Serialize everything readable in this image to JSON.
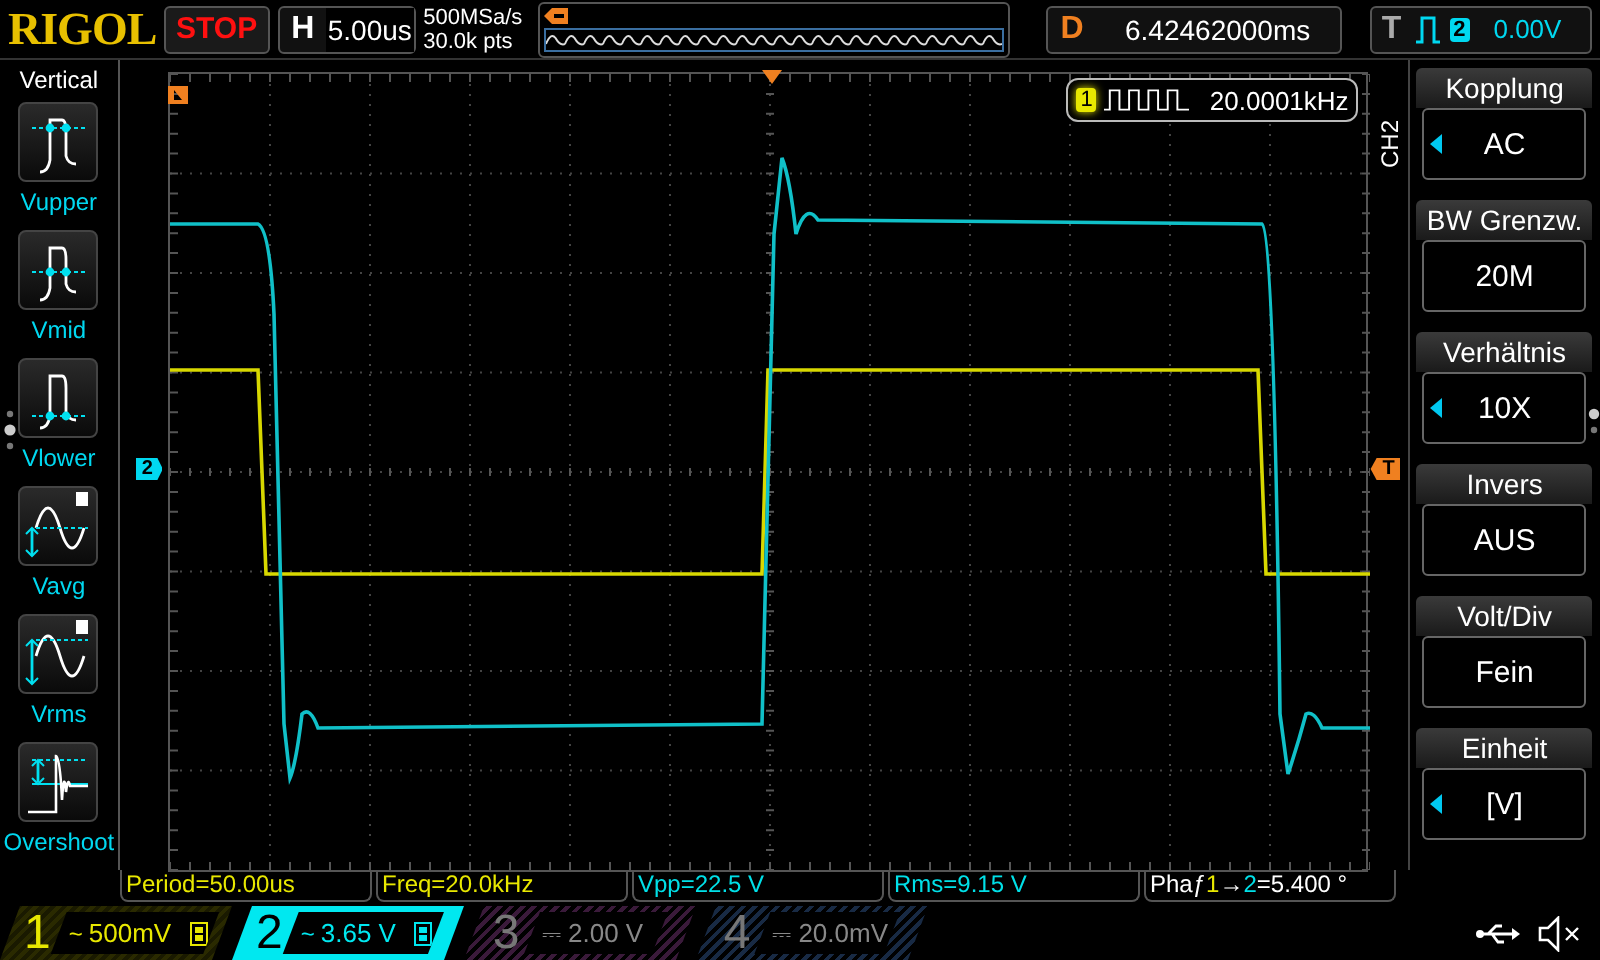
{
  "top_bar": {
    "logo": "RIGOL",
    "run_state": "STOP",
    "timebase": {
      "label": "H",
      "value": "5.00us"
    },
    "sample_rate": "500MSa/s",
    "memory_depth": "30.0k pts",
    "delay": {
      "label": "D",
      "value": "6.42462000ms"
    },
    "trigger": {
      "label": "T",
      "source": "2",
      "level": "0.00V"
    }
  },
  "left_menu": {
    "title": "Vertical",
    "items": [
      {
        "kind": "vupper",
        "label": "Vupper"
      },
      {
        "kind": "vmid",
        "label": "Vmid"
      },
      {
        "kind": "vlower",
        "label": "Vlower"
      },
      {
        "kind": "vavg",
        "label": "Vavg"
      },
      {
        "kind": "vrms",
        "label": "Vrms"
      },
      {
        "kind": "overshoot",
        "label": "Overshoot"
      }
    ]
  },
  "display": {
    "frequency_counter": {
      "channel": "1",
      "value": "20.0001kHz"
    },
    "trigger_marker": "T",
    "channel_marker": "2"
  },
  "right_menu": {
    "channel": "CH2",
    "items": [
      {
        "title": "Kopplung",
        "value": "AC",
        "has_options": true
      },
      {
        "title": "BW Grenzw.",
        "value": "20M",
        "has_options": false
      },
      {
        "title": "Verhältnis",
        "value": "10X",
        "has_options": true
      },
      {
        "title": "Invers",
        "value": "AUS",
        "has_options": false
      },
      {
        "title": "Volt/Div",
        "value": "Fein",
        "has_options": false
      },
      {
        "title": "Einheit",
        "value": "[V]",
        "has_options": true
      }
    ]
  },
  "measurements": [
    {
      "text": "Period=50.00us",
      "color": "#e8e800"
    },
    {
      "text": "Freq=20.0kHz",
      "color": "#e8e800"
    },
    {
      "text": "Vpp=22.5 V",
      "color": "#00e0e8"
    },
    {
      "text": "Rms=9.15 V",
      "color": "#00e0e8"
    },
    {
      "kind": "phase",
      "name": "Phaƒ",
      "from": "1",
      "arrow": "→",
      "to": "2",
      "value": "=5.400 °",
      "color": "#ffffff"
    }
  ],
  "channels": [
    {
      "number": "1",
      "coupling": "~",
      "scale": "500mV",
      "bw_limit": true,
      "enabled": true,
      "selected": false,
      "color": "#e8e800"
    },
    {
      "number": "2",
      "coupling": "~",
      "scale": "3.65 V",
      "bw_limit": true,
      "enabled": true,
      "selected": true,
      "color": "#00e8f0"
    },
    {
      "number": "3",
      "coupling": "⎓",
      "scale": "2.00 V",
      "bw_limit": false,
      "enabled": false,
      "selected": false,
      "color": "#3a1a3a"
    },
    {
      "number": "4",
      "coupling": "⎓",
      "scale": "20.0mV",
      "bw_limit": false,
      "enabled": false,
      "selected": false,
      "color": "#182a44"
    }
  ]
}
